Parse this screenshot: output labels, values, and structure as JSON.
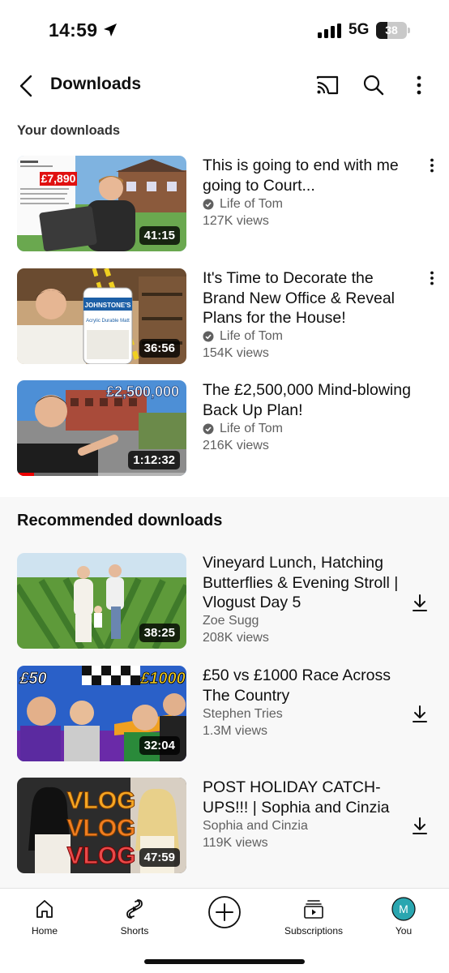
{
  "status_bar": {
    "time": "14:59",
    "network": "5G",
    "battery": "38",
    "battery_level": 0.38
  },
  "header": {
    "title": "Downloads",
    "icons": [
      "back-arrow-icon",
      "cast-icon",
      "search-icon",
      "more-vertical-icon"
    ]
  },
  "your_downloads": {
    "heading": "Your downloads",
    "videos": [
      {
        "title": "This is going to end with me going to Court...",
        "channel": "Life of Tom",
        "verified": true,
        "views": "127K views",
        "duration": "41:15",
        "thumb_amount": "£7,890"
      },
      {
        "title": "It's Time to Decorate the Brand New Office & Reveal Plans for the House!",
        "channel": "Life of Tom",
        "verified": true,
        "views": "154K views",
        "duration": "36:56",
        "thumb_brand": "JOHNSTONE'S",
        "thumb_can_label": "Acrylic Durable Matt"
      },
      {
        "title": "The £2,500,000 Mind-blowing Back Up Plan!",
        "channel": "Life of Tom",
        "verified": true,
        "views": "216K views",
        "duration": "1:12:32",
        "thumb_amount": "£2,500,000",
        "watch_progress": 0.1
      }
    ]
  },
  "recommended": {
    "heading": "Recommended downloads",
    "videos": [
      {
        "title": "Vineyard Lunch, Hatching Butterflies & Evening Stroll | Vlogust Day 5",
        "channel": "Zoe Sugg",
        "views": "208K views",
        "duration": "38:25"
      },
      {
        "title": "£50 vs £1000 Race Across The Country",
        "channel": "Stephen Tries",
        "views": "1.3M views",
        "duration": "32:04",
        "thumb_left": "£50",
        "thumb_right": "£1000"
      },
      {
        "title": "POST HOLIDAY CATCH-UPS!!! | Sophia and Cinzia",
        "channel": "Sophia and Cinzia",
        "views": "119K views",
        "duration": "47:59",
        "thumb_text": "VLOG"
      }
    ]
  },
  "bottom_nav": {
    "items": [
      {
        "label": "Home",
        "icon": "home-icon"
      },
      {
        "label": "Shorts",
        "icon": "shorts-icon"
      },
      {
        "label": "",
        "icon": "create-plus-icon"
      },
      {
        "label": "Subscriptions",
        "icon": "subscriptions-icon"
      },
      {
        "label": "You",
        "icon": "avatar",
        "avatar_letter": "M",
        "avatar_color": "#2aa6b0"
      }
    ]
  },
  "colors": {
    "progress_red": "#ff0000",
    "avatar_teal": "#2aa6b0"
  }
}
